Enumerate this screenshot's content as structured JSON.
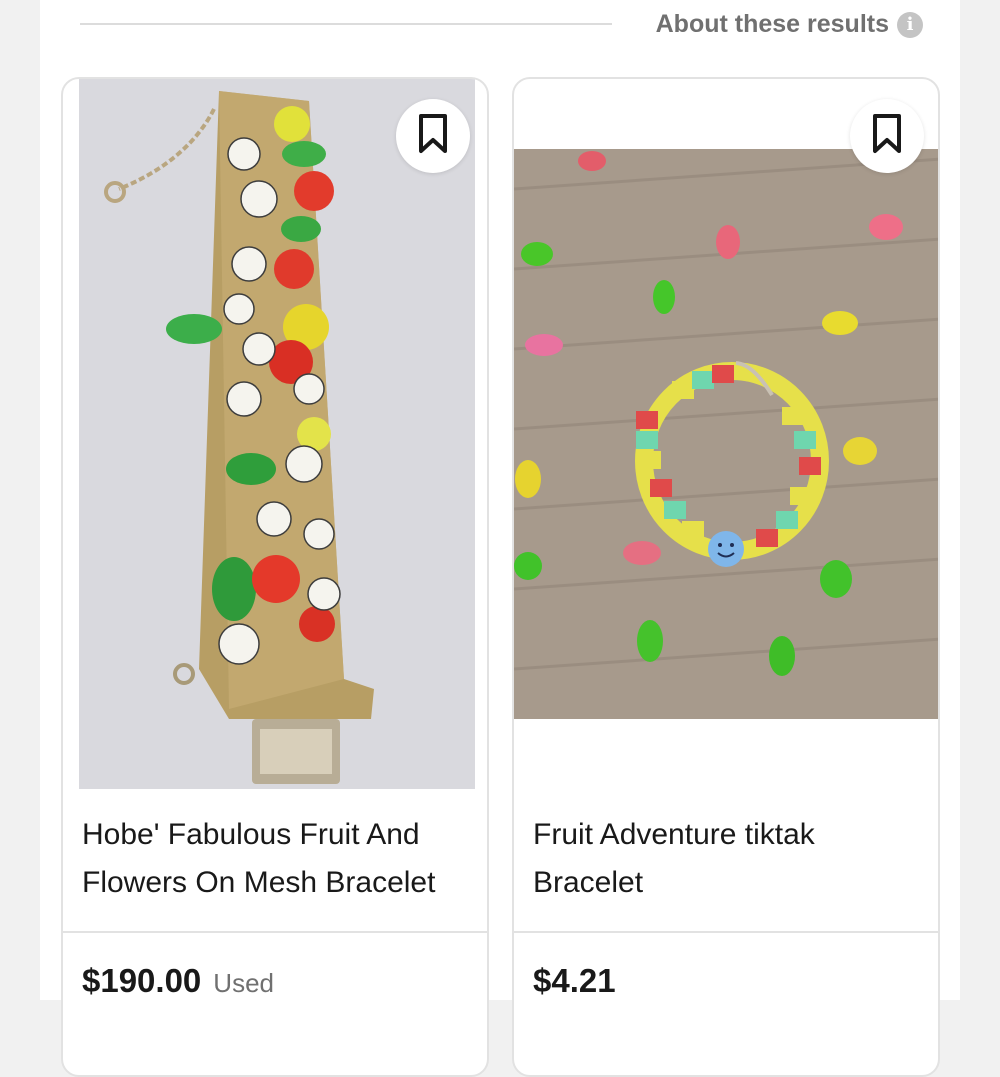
{
  "header": {
    "about_label": "About these results",
    "info_icon": "i"
  },
  "results": [
    {
      "title": "Hobe' Fabulous Fruit And Flowers On Mesh Bracelet",
      "price": "$190.00",
      "condition": "Used",
      "image_icon": "mesh-bracelet-photo"
    },
    {
      "title": "Fruit Adventure tiktak Bracelet",
      "price": "$4.21",
      "condition": "",
      "image_icon": "beaded-bracelet-photo"
    }
  ],
  "colors": {
    "text_primary": "#191919",
    "text_secondary": "#707070",
    "border": "#e2e2e2"
  }
}
